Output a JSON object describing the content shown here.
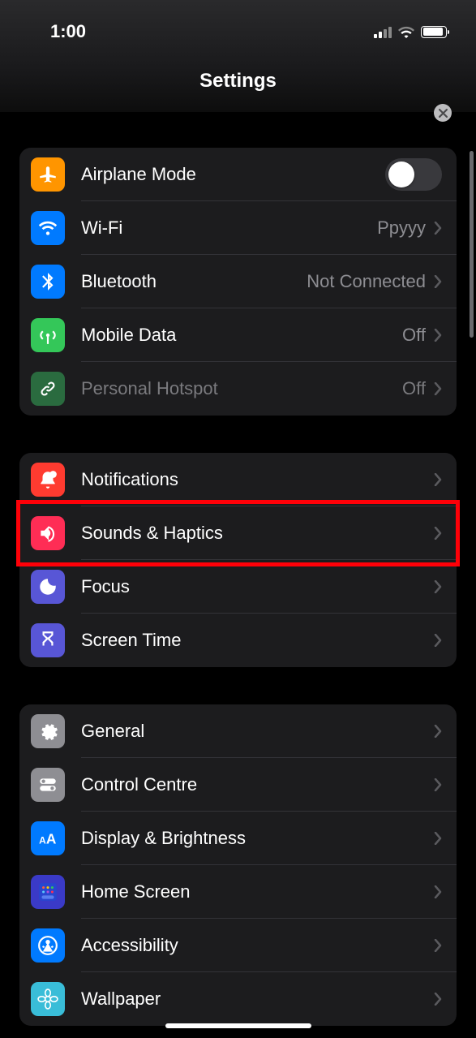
{
  "status": {
    "time": "1:00"
  },
  "title": "Settings",
  "groups": [
    {
      "rows": [
        {
          "id": "airplane",
          "icon": "airplane-icon",
          "color": "#ff9500",
          "label": "Airplane Mode",
          "toggle": false
        },
        {
          "id": "wifi",
          "icon": "wifi-icon",
          "color": "#007aff",
          "label": "Wi-Fi",
          "value": "Ppyyy",
          "chevron": true
        },
        {
          "id": "bluetooth",
          "icon": "bluetooth-icon",
          "color": "#007aff",
          "label": "Bluetooth",
          "value": "Not Connected",
          "chevron": true
        },
        {
          "id": "mobiledata",
          "icon": "antenna-icon",
          "color": "#34c759",
          "label": "Mobile Data",
          "value": "Off",
          "chevron": true
        },
        {
          "id": "hotspot",
          "icon": "link-icon",
          "color": "#2a6b3f",
          "label": "Personal Hotspot",
          "value": "Off",
          "chevron": true,
          "dim": true
        }
      ]
    },
    {
      "rows": [
        {
          "id": "notifications",
          "icon": "bell-icon",
          "color": "#ff3b30",
          "label": "Notifications",
          "chevron": true
        },
        {
          "id": "sounds",
          "icon": "speaker-icon",
          "color": "#ff2d55",
          "label": "Sounds & Haptics",
          "chevron": true,
          "highlight": true
        },
        {
          "id": "focus",
          "icon": "moon-icon",
          "color": "#5856d6",
          "label": "Focus",
          "chevron": true
        },
        {
          "id": "screentime",
          "icon": "hourglass-icon",
          "color": "#5856d6",
          "label": "Screen Time",
          "chevron": true
        }
      ]
    },
    {
      "rows": [
        {
          "id": "general",
          "icon": "gear-icon",
          "color": "#8e8e93",
          "label": "General",
          "chevron": true
        },
        {
          "id": "controlcentre",
          "icon": "switches-icon",
          "color": "#8e8e93",
          "label": "Control Centre",
          "chevron": true
        },
        {
          "id": "display",
          "icon": "aa-icon",
          "color": "#007aff",
          "label": "Display & Brightness",
          "chevron": true
        },
        {
          "id": "homescreen",
          "icon": "grid-icon",
          "color": "#3a3ac7",
          "label": "Home Screen",
          "chevron": true
        },
        {
          "id": "accessibility",
          "icon": "person-icon",
          "color": "#007aff",
          "label": "Accessibility",
          "chevron": true
        },
        {
          "id": "wallpaper",
          "icon": "flower-icon",
          "color": "#39bdd8",
          "label": "Wallpaper",
          "chevron": true
        }
      ]
    }
  ]
}
